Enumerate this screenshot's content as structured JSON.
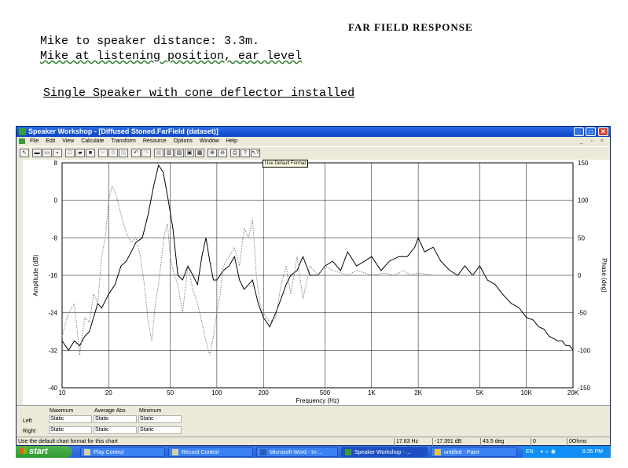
{
  "document": {
    "title": "FAR FIELD RESPONSE",
    "line1": "Mike to speaker distance: 3.3m.",
    "line2": "Mike at listening position, ear level",
    "line3": "Single Speaker with cone deflector installed"
  },
  "window": {
    "title": "Speaker Workshop - [Diffused Stoned.FarField (dataset)]",
    "menu": [
      "File",
      "Edit",
      "View",
      "Calculate",
      "Transform",
      "Resource",
      "Options",
      "Window",
      "Help"
    ],
    "tooltip": "Use Default Format"
  },
  "chart_data": {
    "type": "line",
    "xlabel": "Frequency (Hz)",
    "ylabel": "Amplitude (dB)",
    "y2label": "Phase (deg)",
    "xscale": "log",
    "xlim": [
      10,
      20000
    ],
    "ylim": [
      -40,
      8
    ],
    "y2lim": [
      -150,
      150
    ],
    "grid": true,
    "x_ticks": [
      {
        "v": 10,
        "label": "10"
      },
      {
        "v": 20,
        "label": "20"
      },
      {
        "v": 50,
        "label": "50"
      },
      {
        "v": 100,
        "label": "100"
      },
      {
        "v": 200,
        "label": "200"
      },
      {
        "v": 500,
        "label": "500"
      },
      {
        "v": 1000,
        "label": "1K"
      },
      {
        "v": 2000,
        "label": "2K"
      },
      {
        "v": 5000,
        "label": "5K"
      },
      {
        "v": 10000,
        "label": "10K"
      },
      {
        "v": 20000,
        "label": "20K"
      }
    ],
    "y_ticks": [
      "8",
      "0",
      "-8",
      "-16",
      "-24",
      "-32",
      "-40"
    ],
    "y2_ticks": [
      "150",
      "100",
      "50",
      "0",
      "-50",
      "-100",
      "-150"
    ],
    "series": [
      {
        "style": "solid",
        "color": "#000000",
        "x": [
          10,
          11,
          12,
          13,
          14,
          15,
          17,
          18,
          20,
          22,
          24,
          26,
          28,
          30,
          33,
          36,
          39,
          42,
          45,
          48,
          52,
          56,
          60,
          65,
          70,
          75,
          80,
          85,
          90,
          95,
          100,
          110,
          120,
          130,
          140,
          150,
          170,
          185,
          200,
          220,
          240,
          260,
          280,
          300,
          330,
          360,
          400,
          450,
          500,
          560,
          630,
          700,
          800,
          900,
          1000,
          1150,
          1300,
          1500,
          1700,
          1900,
          2000,
          2200,
          2500,
          2800,
          3200,
          3600,
          4000,
          4500,
          5000,
          5600,
          6300,
          7000,
          8000,
          9000,
          10000,
          11000,
          12000,
          13000,
          14000,
          15000,
          16000,
          17000,
          18000,
          19000,
          20000
        ],
        "y": [
          -30,
          -32,
          -30,
          -31,
          -29,
          -28,
          -22,
          -23,
          -20,
          -18,
          -14,
          -13,
          -11,
          -9,
          -8,
          -3,
          3,
          7.5,
          6,
          1,
          -6,
          -16,
          -17,
          -14,
          -16,
          -18,
          -12,
          -8,
          -13,
          -17,
          -17,
          -15,
          -14,
          -12,
          -17,
          -19,
          -17,
          -22,
          -25,
          -27,
          -24,
          -21,
          -18,
          -16,
          -15,
          -12,
          -16,
          -16,
          -14,
          -13,
          -15,
          -11,
          -14,
          -13,
          -12,
          -15,
          -13,
          -12,
          -12,
          -10,
          -8,
          -11,
          -10,
          -13,
          -15,
          -16,
          -14,
          -16,
          -14,
          -17,
          -18,
          -20,
          -22,
          -23,
          -25,
          -25.5,
          -27,
          -27.5,
          -29,
          -29.5,
          -30,
          -30,
          -31,
          -31,
          -32
        ]
      },
      {
        "style": "dotted",
        "color": "#777777",
        "x": [
          10,
          11,
          12,
          13,
          14,
          15,
          16,
          17,
          18,
          19,
          20,
          21,
          22,
          24,
          26,
          28,
          30,
          32,
          34,
          36,
          38,
          40,
          42,
          44,
          46,
          48,
          50,
          53,
          56,
          60,
          65,
          70,
          75,
          80,
          85,
          90,
          95,
          100,
          105,
          110,
          120,
          130,
          140,
          150,
          160,
          170,
          180,
          190,
          200,
          220,
          240,
          260,
          280,
          300,
          330,
          360,
          400,
          450,
          500,
          560,
          630,
          700,
          800,
          900,
          1000,
          1200,
          1400,
          1600,
          1800,
          2000,
          2500,
          3000,
          4000,
          5000,
          6000,
          8000,
          10000,
          12000,
          15000,
          20000
        ],
        "y": [
          -29,
          -24,
          -22,
          -33,
          -25,
          -26,
          -20,
          -22,
          -12,
          -8,
          0,
          3,
          2,
          -3,
          -7,
          -9,
          -8,
          -12,
          -18,
          -26,
          -30,
          -22,
          -18,
          -12,
          -7,
          -5,
          -12,
          -16,
          -18,
          -24,
          -14,
          -19,
          -22,
          -26,
          -30,
          -33,
          -29,
          -24,
          -20,
          -14,
          -12,
          -10,
          -14,
          -6,
          -8,
          -4,
          -16,
          -22,
          -24,
          -26,
          -25,
          -18,
          -14,
          -20,
          -12,
          -21,
          -14,
          -16,
          -14,
          -15,
          -15.5,
          -16,
          -15,
          -15.5,
          -16,
          -15.5,
          -16,
          -15,
          -16,
          -15.5,
          -16,
          -16,
          -16,
          -16,
          -16,
          -16,
          -16,
          -16,
          -16,
          -16
        ]
      }
    ]
  },
  "stats": {
    "headers": [
      "Maximum",
      "Average Abs",
      "Minimum"
    ],
    "rows": [
      {
        "label": "Left",
        "values": [
          "Static",
          "Static",
          "Static"
        ]
      },
      {
        "label": "Right",
        "values": [
          "Static",
          "Static",
          "Static"
        ]
      }
    ]
  },
  "statusbar": {
    "message": "Use the default chart format for this chart",
    "fields": [
      "17.83 Hz",
      "-17.391 dB",
      "43.5 deg",
      "0",
      "0Ohms"
    ]
  },
  "taskbar": {
    "start": "start",
    "tasks": [
      "Play Control",
      "Record Control",
      "Microsoft Word - In-...",
      "Speaker Workshop - ...",
      "untitled - Paint"
    ],
    "lang": "EN",
    "time": "8:35 PM"
  }
}
